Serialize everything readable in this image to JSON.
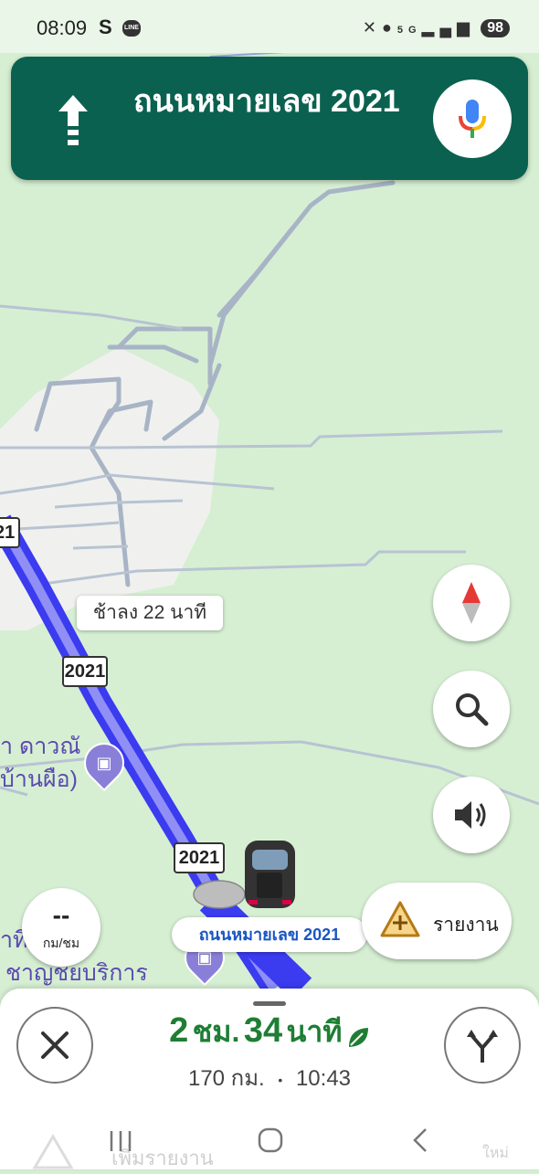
{
  "status_bar": {
    "time": "08:09",
    "s_icon": "S",
    "line_icon": "LINE",
    "icons": [
      "mute-vibrate-icon",
      "location-icon",
      "5g-icon",
      "signal-icon"
    ],
    "network": "5G",
    "battery": "98"
  },
  "nav_banner": {
    "maneuver_icon": "arrow-straight-icon",
    "street_name": "ถนนหมายเลข 2021",
    "mic_icon": "google-mic-icon",
    "color": "#0b6150"
  },
  "map": {
    "delay_callout": "ช้าลง 22 นาที",
    "route_shields": [
      "2021",
      "2021",
      "2021"
    ],
    "current_road_label": "ถนนหมายเลข 2021",
    "poi_left_top": "า ดาวณั",
    "poi_left_top2": "บ้านผือ)",
    "poi_bottom_line1": "าที่ น้ำมัน",
    "poi_bottom_line2": "ชาญชยบริการ",
    "route_color": "#3b3bf0"
  },
  "controls": {
    "compass_icon": "compass-icon",
    "search_icon": "search-icon",
    "sound_icon": "volume-icon",
    "report_icon": "report-add-icon",
    "report_label": "รายงาน",
    "speed_value": "--",
    "speed_unit": "กม/ชม"
  },
  "bottom_sheet": {
    "close_icon": "close-icon",
    "eta_hours": "2",
    "eta_hours_unit": "ชม.",
    "eta_minutes": "34",
    "eta_minutes_unit": "นาที",
    "eco_icon": "leaf-icon",
    "distance": "170 กม.",
    "arrival_time": "10:43",
    "alt_routes_icon": "route-split-icon",
    "behind_text_left": "เพิ่มรายงาน",
    "behind_text_right": "ใหม่"
  },
  "system_nav": {
    "recents_icon": "recents-icon",
    "home_icon": "home-icon",
    "back_icon": "back-icon"
  }
}
